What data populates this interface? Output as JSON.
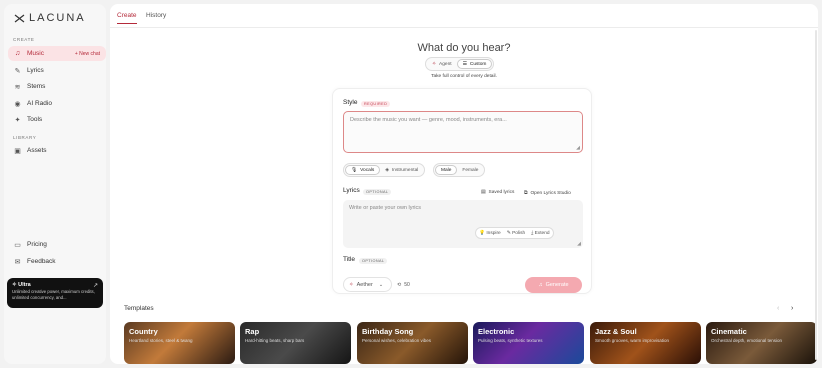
{
  "sidebar": {
    "logo": "LACUNA",
    "create_section": "CREATE",
    "library_section": "LIBRARY",
    "new_chat": "+ New chat",
    "items": [
      {
        "label": "Music",
        "icon": "music-note-icon"
      },
      {
        "label": "Lyrics",
        "icon": "lyrics-icon"
      },
      {
        "label": "Stems",
        "icon": "stems-icon"
      },
      {
        "label": "AI Radio",
        "icon": "radio-icon"
      },
      {
        "label": "Tools",
        "icon": "tools-icon"
      }
    ],
    "library_items": [
      {
        "label": "Assets",
        "icon": "assets-icon"
      }
    ],
    "bottom_items": [
      {
        "label": "Pricing",
        "icon": "pricing-icon"
      },
      {
        "label": "Feedback",
        "icon": "feedback-icon"
      }
    ],
    "promo": {
      "title": "Ultra",
      "description": "Unlimited creative power, maximum credits, unlimited concurrency, and..."
    }
  },
  "tabs": [
    "Create",
    "History"
  ],
  "main": {
    "heading": "What do you hear?",
    "mode_options": [
      "Agent",
      "Custom"
    ],
    "mode_selected": "Custom",
    "mode_subtitle": "Take full control of every detail.",
    "style": {
      "label": "Style",
      "badge": "REQUIRED",
      "placeholder": "Describe the music you want — genre, mood, instruments, era..."
    },
    "vocal_options": [
      "Vocals",
      "Instrumental"
    ],
    "voice_options": [
      "Male",
      "Female"
    ],
    "lyrics": {
      "label": "Lyrics",
      "badge": "OPTIONAL",
      "saved": "Saved lyrics",
      "studio": "Open Lyrics Studio",
      "placeholder": "Write or paste your own lyrics",
      "actions": [
        "Inspire",
        "Polish",
        "Extend"
      ]
    },
    "title": {
      "label": "Title",
      "badge": "OPTIONAL"
    },
    "model": "Aether",
    "credits": "50",
    "generate": "Generate"
  },
  "templates": {
    "title": "Templates",
    "items": [
      {
        "title": "Country",
        "desc": "Heartland stories, steel & twang"
      },
      {
        "title": "Rap",
        "desc": "Hard-hitting beats, sharp bars"
      },
      {
        "title": "Birthday Song",
        "desc": "Personal wishes, celebration vibes"
      },
      {
        "title": "Electronic",
        "desc": "Pulsing beats, synthetic textures"
      },
      {
        "title": "Jazz & Soul",
        "desc": "Smooth grooves, warm improvisation"
      },
      {
        "title": "Cinematic",
        "desc": "Orchestral depth, emotional tension"
      }
    ]
  },
  "colors": {
    "accent": "#b42a3a",
    "generate_bg": "#f4a9b0",
    "active_nav_bg": "#fbe3e5"
  }
}
